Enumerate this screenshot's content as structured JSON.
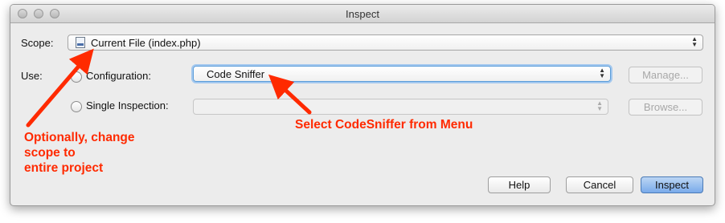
{
  "window": {
    "title": "Inspect"
  },
  "scope": {
    "label": "Scope:",
    "selected": "Current File (index.php)"
  },
  "use": {
    "label": "Use:",
    "configuration_label": "Configuration:",
    "configuration_selected": "Code Sniffer",
    "manage_label": "Manage...",
    "single_inspection_label": "Single Inspection:",
    "single_inspection_selected": "",
    "browse_label": "Browse..."
  },
  "buttons": {
    "help": "Help",
    "cancel": "Cancel",
    "inspect": "Inspect"
  },
  "annotations": {
    "scope_note_line1": "Optionally, change",
    "scope_note_line2": "scope to",
    "scope_note_line3": "entire project",
    "menu_note": "Select CodeSniffer from Menu"
  },
  "colors": {
    "annotation": "#ff2a00",
    "default_button": "#79aaea",
    "focus_ring": "#5b9dd9"
  }
}
